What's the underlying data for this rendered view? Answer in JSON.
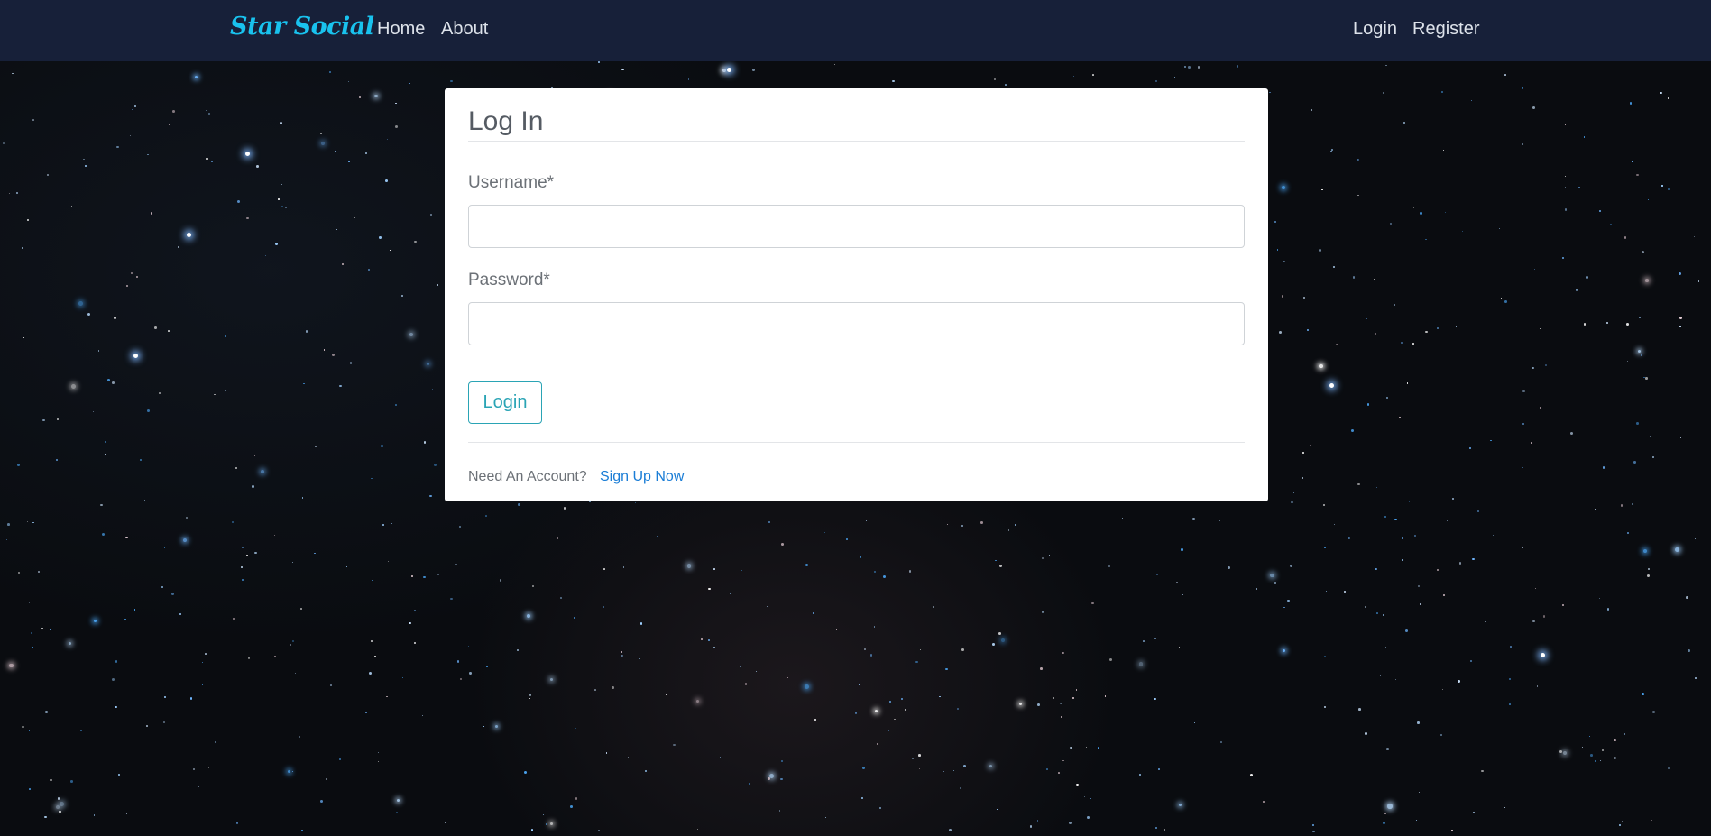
{
  "navbar": {
    "brand": "Star Social",
    "links": {
      "home": "Home",
      "about": "About",
      "login": "Login",
      "register": "Register"
    }
  },
  "login_card": {
    "title": "Log In",
    "username_label": "Username*",
    "username_value": "",
    "password_label": "Password*",
    "password_value": "",
    "submit_label": "Login",
    "footer_text": "Need An Account?",
    "signup_link": "Sign Up Now"
  },
  "colors": {
    "navbar_bg": "#172039",
    "brand": "#19c2ee",
    "button_accent": "#2aa4b5",
    "link": "#1a7dd6"
  }
}
